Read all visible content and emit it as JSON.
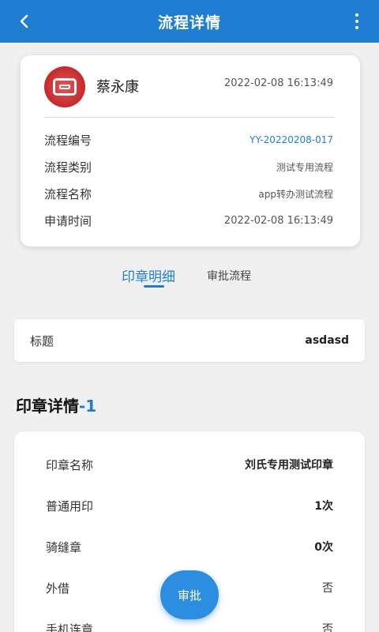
{
  "header": {
    "title": "流程详情",
    "back_icon": "back-arrow-icon",
    "more_icon": "more-vertical-icon"
  },
  "applicant": {
    "avatar_icon": "seal-icon",
    "name": "蔡永康",
    "time": "2022-02-08 16:13:49"
  },
  "process_info": [
    {
      "label": "流程编号",
      "value": "YY-20220208-017"
    },
    {
      "label": "流程类别",
      "value": "测试专用流程"
    },
    {
      "label": "流程名称",
      "value": "app转办测试流程"
    },
    {
      "label": "申请时间",
      "value": "2022-02-08 16:13:49"
    }
  ],
  "tabs": [
    {
      "label": "印章明细",
      "active": true
    },
    {
      "label": "审批流程",
      "active": false
    }
  ],
  "title_row": {
    "label": "标题",
    "value": "asdasd"
  },
  "seal_section": {
    "title": "印章详情",
    "index": "-1"
  },
  "seal_details": [
    {
      "label": "印章名称",
      "value": "刘氏专用测试印章"
    },
    {
      "label": "普通用印",
      "value": "1次"
    },
    {
      "label": "骑缝章",
      "value": "0次"
    },
    {
      "label": "外借",
      "value": "否"
    },
    {
      "label": "手机连章",
      "value": "否"
    }
  ],
  "approve_button": {
    "label": "审批"
  },
  "colors": {
    "primary": "#1f7ed1",
    "seal_red": "#c6282a",
    "background": "#f0f0f0"
  }
}
